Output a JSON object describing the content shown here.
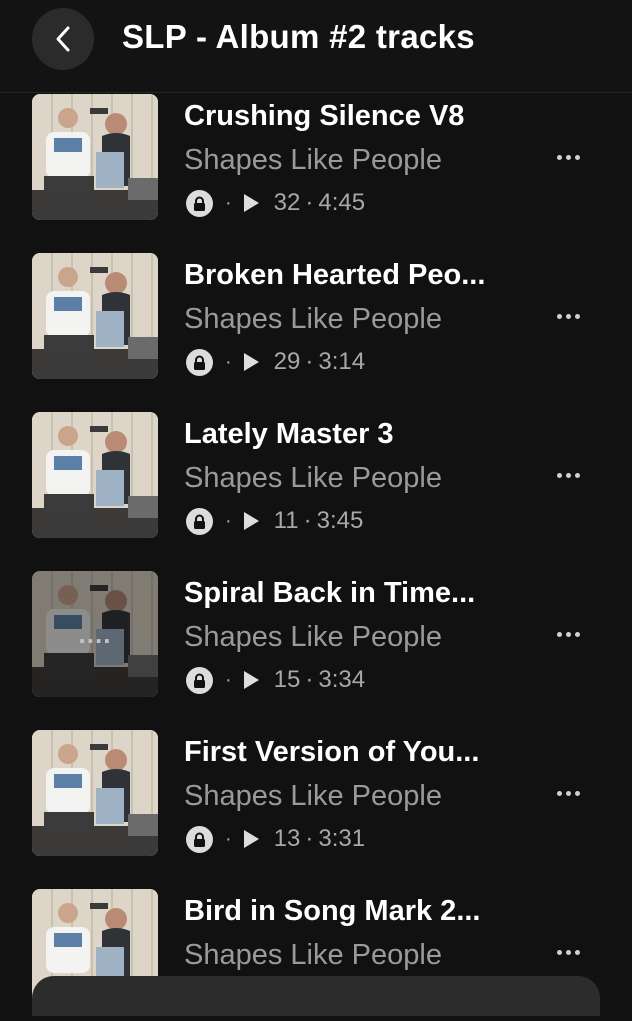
{
  "header": {
    "back_label": "Back",
    "title": "SLP - Album #2 tracks"
  },
  "tracks": [
    {
      "title": "Crushing Silence V8",
      "artist": "Shapes Like People",
      "plays": "32",
      "duration": "4:45"
    },
    {
      "title": "Broken Hearted Peo...",
      "artist": "Shapes Like People",
      "plays": "29",
      "duration": "3:14"
    },
    {
      "title": "Lately Master 3",
      "artist": "Shapes Like People",
      "plays": "11",
      "duration": "3:45"
    },
    {
      "title": "Spiral Back in Time...",
      "artist": "Shapes Like People",
      "plays": "15",
      "duration": "3:34",
      "overlay": "...."
    },
    {
      "title": "First Version of You...",
      "artist": "Shapes Like People",
      "plays": "13",
      "duration": "3:31"
    },
    {
      "title": "Bird in Song Mark 2...",
      "artist": "Shapes Like People"
    }
  ],
  "colors": {
    "background": "#111111",
    "header_bg": "#131313",
    "secondary_text": "#9a9a9a",
    "button_bg": "#2b2b2b"
  },
  "icons": {
    "back": "chevron-left-icon",
    "private": "lock-icon",
    "plays": "play-icon",
    "more": "more-horizontal-icon"
  }
}
